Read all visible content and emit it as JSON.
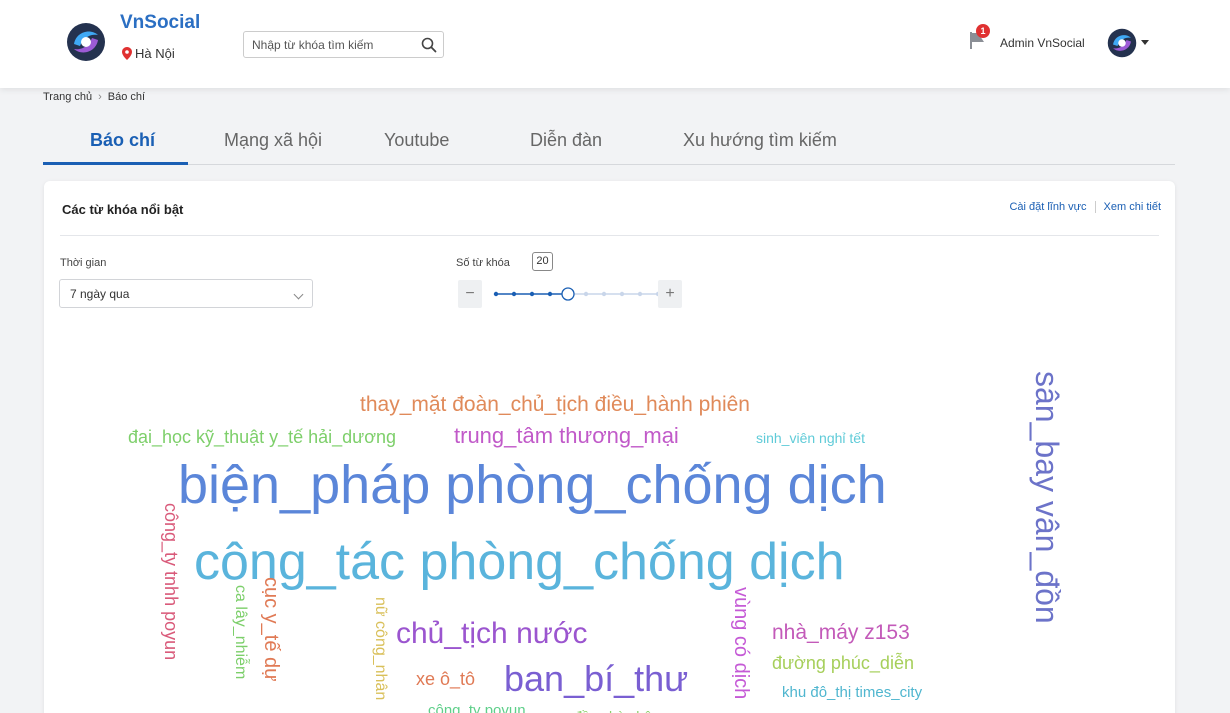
{
  "header": {
    "brand": "VnSocial",
    "location": "Hà Nội",
    "search_placeholder": "Nhập từ khóa tìm kiếm",
    "notification_count": "1",
    "user_name": "Admin VnSocial"
  },
  "breadcrumb": {
    "home": "Trang chủ",
    "current": "Báo chí"
  },
  "tabs": [
    {
      "label": "Báo chí",
      "active": true
    },
    {
      "label": "Mạng xã hội",
      "active": false
    },
    {
      "label": "Youtube",
      "active": false
    },
    {
      "label": "Diễn đàn",
      "active": false
    },
    {
      "label": "Xu hướng tìm kiếm",
      "active": false
    }
  ],
  "card": {
    "title": "Các từ khóa nổi bật",
    "link_settings": "Cài đặt lĩnh vực",
    "link_details": "Xem chi tiết"
  },
  "filters": {
    "time_label": "Thời gian",
    "time_value": "7 ngày qua",
    "count_label": "Số từ khóa",
    "count_value": "20",
    "slider_steps": 10,
    "slider_selected_step": 5
  },
  "word_cloud": [
    {
      "text": "biện_pháp phòng_chống dịch",
      "color": "#5b86d9"
    },
    {
      "text": "công_tác phòng_chống dịch",
      "color": "#5ab4dc"
    },
    {
      "text": "sân_bay vân_đồn",
      "color": "#6c73c9"
    },
    {
      "text": "thay_mặt đoàn_chủ_tịch điều_hành phiên",
      "color": "#e08a5a"
    },
    {
      "text": "đại_học kỹ_thuật y_tế hải_dương",
      "color": "#7dcf6a"
    },
    {
      "text": "trung_tâm thương_mại",
      "color": "#c15ac9"
    },
    {
      "text": "sinh_viên nghỉ tết",
      "color": "#5fcbd8"
    },
    {
      "text": "chủ_tịch nước",
      "color": "#9b55cf"
    },
    {
      "text": "ban_bí_thư",
      "color": "#7a5fd2"
    },
    {
      "text": "nhà_máy z153",
      "color": "#c35ab9"
    },
    {
      "text": "đường phúc_diễn",
      "color": "#a6cf5a"
    },
    {
      "text": "khu đô_thị times_city",
      "color": "#4fb6cf"
    },
    {
      "text": "xe ô_tô",
      "color": "#e07a55"
    },
    {
      "text": "công_ty povun",
      "color": "#5fcf8a"
    },
    {
      "text": "đồng bào bộ",
      "color": "#8acf6a"
    },
    {
      "text": "công_ty tnhh poyun",
      "color": "#d95a7a"
    },
    {
      "text": "ca lây_nhiễm",
      "color": "#7ccf6a"
    },
    {
      "text": "cục y_tế dự",
      "color": "#e07a55"
    },
    {
      "text": "nữ công_nhân",
      "color": "#d9c05a"
    },
    {
      "text": "vùng có dịch",
      "color": "#c55ad6"
    }
  ]
}
